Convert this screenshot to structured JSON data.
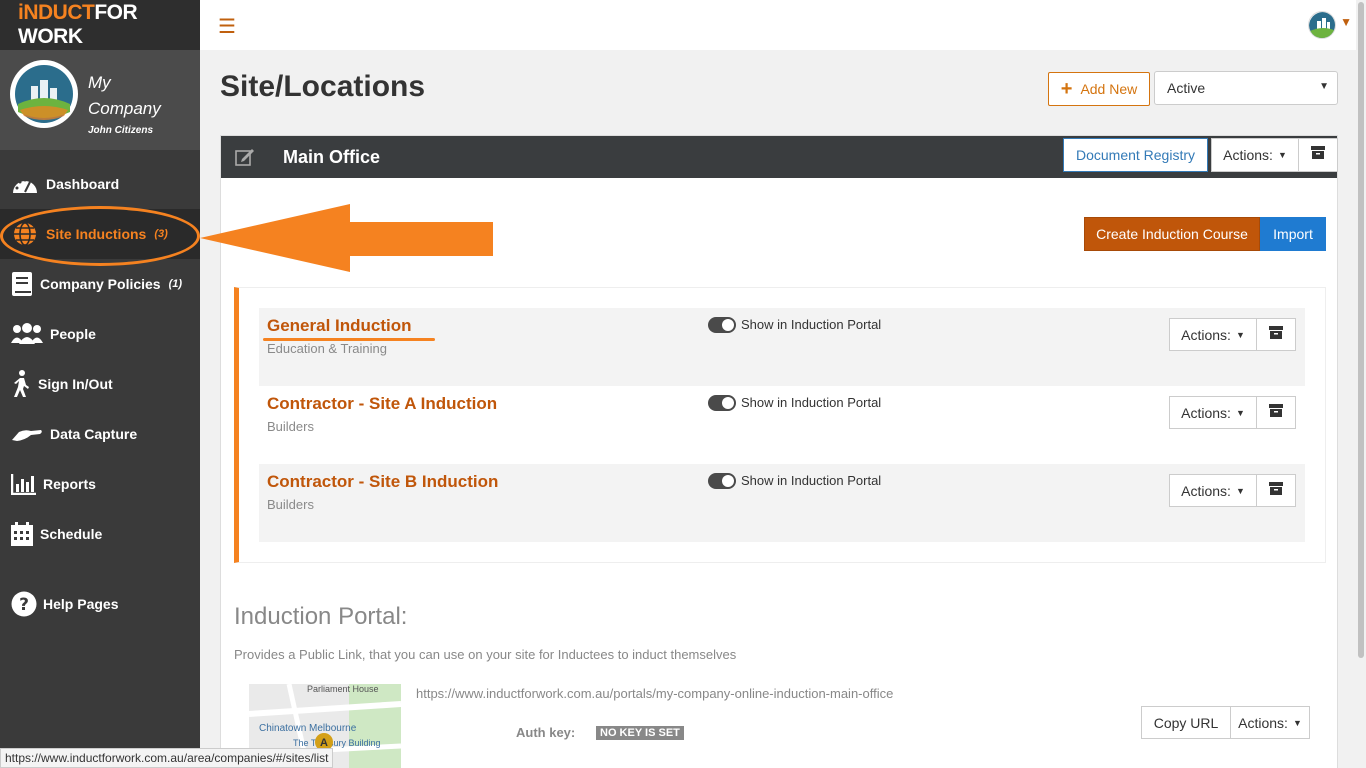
{
  "brand": {
    "logo_part1": "iNDUCT",
    "logo_part2": "FOR WORK",
    "accent": "#f58220"
  },
  "company": {
    "name": "My Company",
    "user": "John Citizens"
  },
  "sidebar": {
    "items": [
      {
        "label": "Dashboard",
        "icon": "speedometer-icon",
        "count": ""
      },
      {
        "label": "Site Inductions",
        "icon": "globe-icon",
        "count": "(3)"
      },
      {
        "label": "Company Policies",
        "icon": "book-icon",
        "count": "(1)"
      },
      {
        "label": "People",
        "icon": "people-icon",
        "count": ""
      },
      {
        "label": "Sign In/Out",
        "icon": "walking-icon",
        "count": ""
      },
      {
        "label": "Data Capture",
        "icon": "hand-icon",
        "count": ""
      },
      {
        "label": "Reports",
        "icon": "bar-chart-icon",
        "count": ""
      },
      {
        "label": "Schedule",
        "icon": "calendar-icon",
        "count": ""
      },
      {
        "label": "Help Pages",
        "icon": "help-icon",
        "count": ""
      }
    ]
  },
  "header": {
    "title": "Site/Locations",
    "add_new_label": "Add New",
    "status_filter": "Active"
  },
  "panel": {
    "title": "Main Office",
    "doc_registry_label": "Document Registry",
    "actions_label": "Actions:",
    "create_course_label": "Create Induction Course",
    "import_label": "Import"
  },
  "courses": [
    {
      "title": "General Induction",
      "category": "Education & Training",
      "toggle_label": "Show in Induction Portal",
      "actions_label": "Actions:"
    },
    {
      "title": "Contractor - Site A Induction",
      "category": "Builders",
      "toggle_label": "Show in Induction Portal",
      "actions_label": "Actions:"
    },
    {
      "title": "Contractor - Site B Induction",
      "category": "Builders",
      "toggle_label": "Show in Induction Portal",
      "actions_label": "Actions:"
    }
  ],
  "portal": {
    "title": "Induction Portal:",
    "description": "Provides a Public Link, that you can use on your site for Inductees to induct themselves",
    "url": "https://www.inductforwork.com.au/portals/my-company-online-induction-main-office",
    "auth_label": "Auth key:",
    "auth_value": "NO KEY IS SET",
    "copy_label": "Copy URL",
    "actions_label": "Actions:",
    "map": {
      "label1": "Parliament House",
      "label2": "Chinatown Melbourne",
      "label3": "The Treasury Building",
      "marker": "A"
    }
  },
  "status_bar": {
    "link": "https://www.inductforwork.com.au/area/companies/#/sites/list"
  }
}
